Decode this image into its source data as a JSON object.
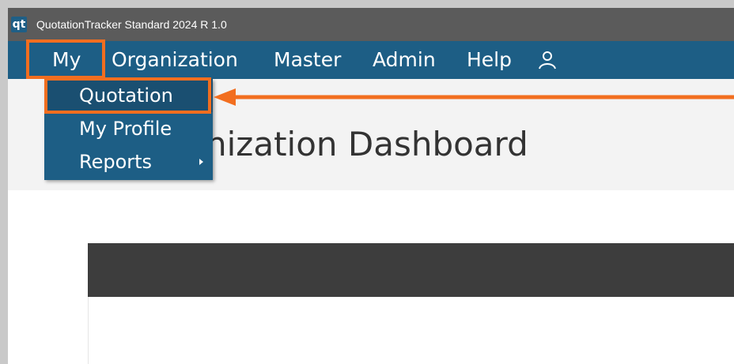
{
  "window": {
    "title": "QuotationTracker Standard 2024 R 1.0",
    "app_icon_text": "qt"
  },
  "menubar": {
    "items": [
      "My",
      "Organization",
      "Master",
      "Admin",
      "Help"
    ],
    "user_icon": "user-icon"
  },
  "dropdown": {
    "items": [
      "Quotation",
      "My Profile",
      "Reports"
    ],
    "selected": "Quotation"
  },
  "page": {
    "title_visible": "nization Dashboard"
  },
  "colors": {
    "accent": "#1d5e85",
    "annotation": "#f26e1f",
    "titlebar": "#5b5b5b",
    "panel_header": "#3d3d3d"
  }
}
